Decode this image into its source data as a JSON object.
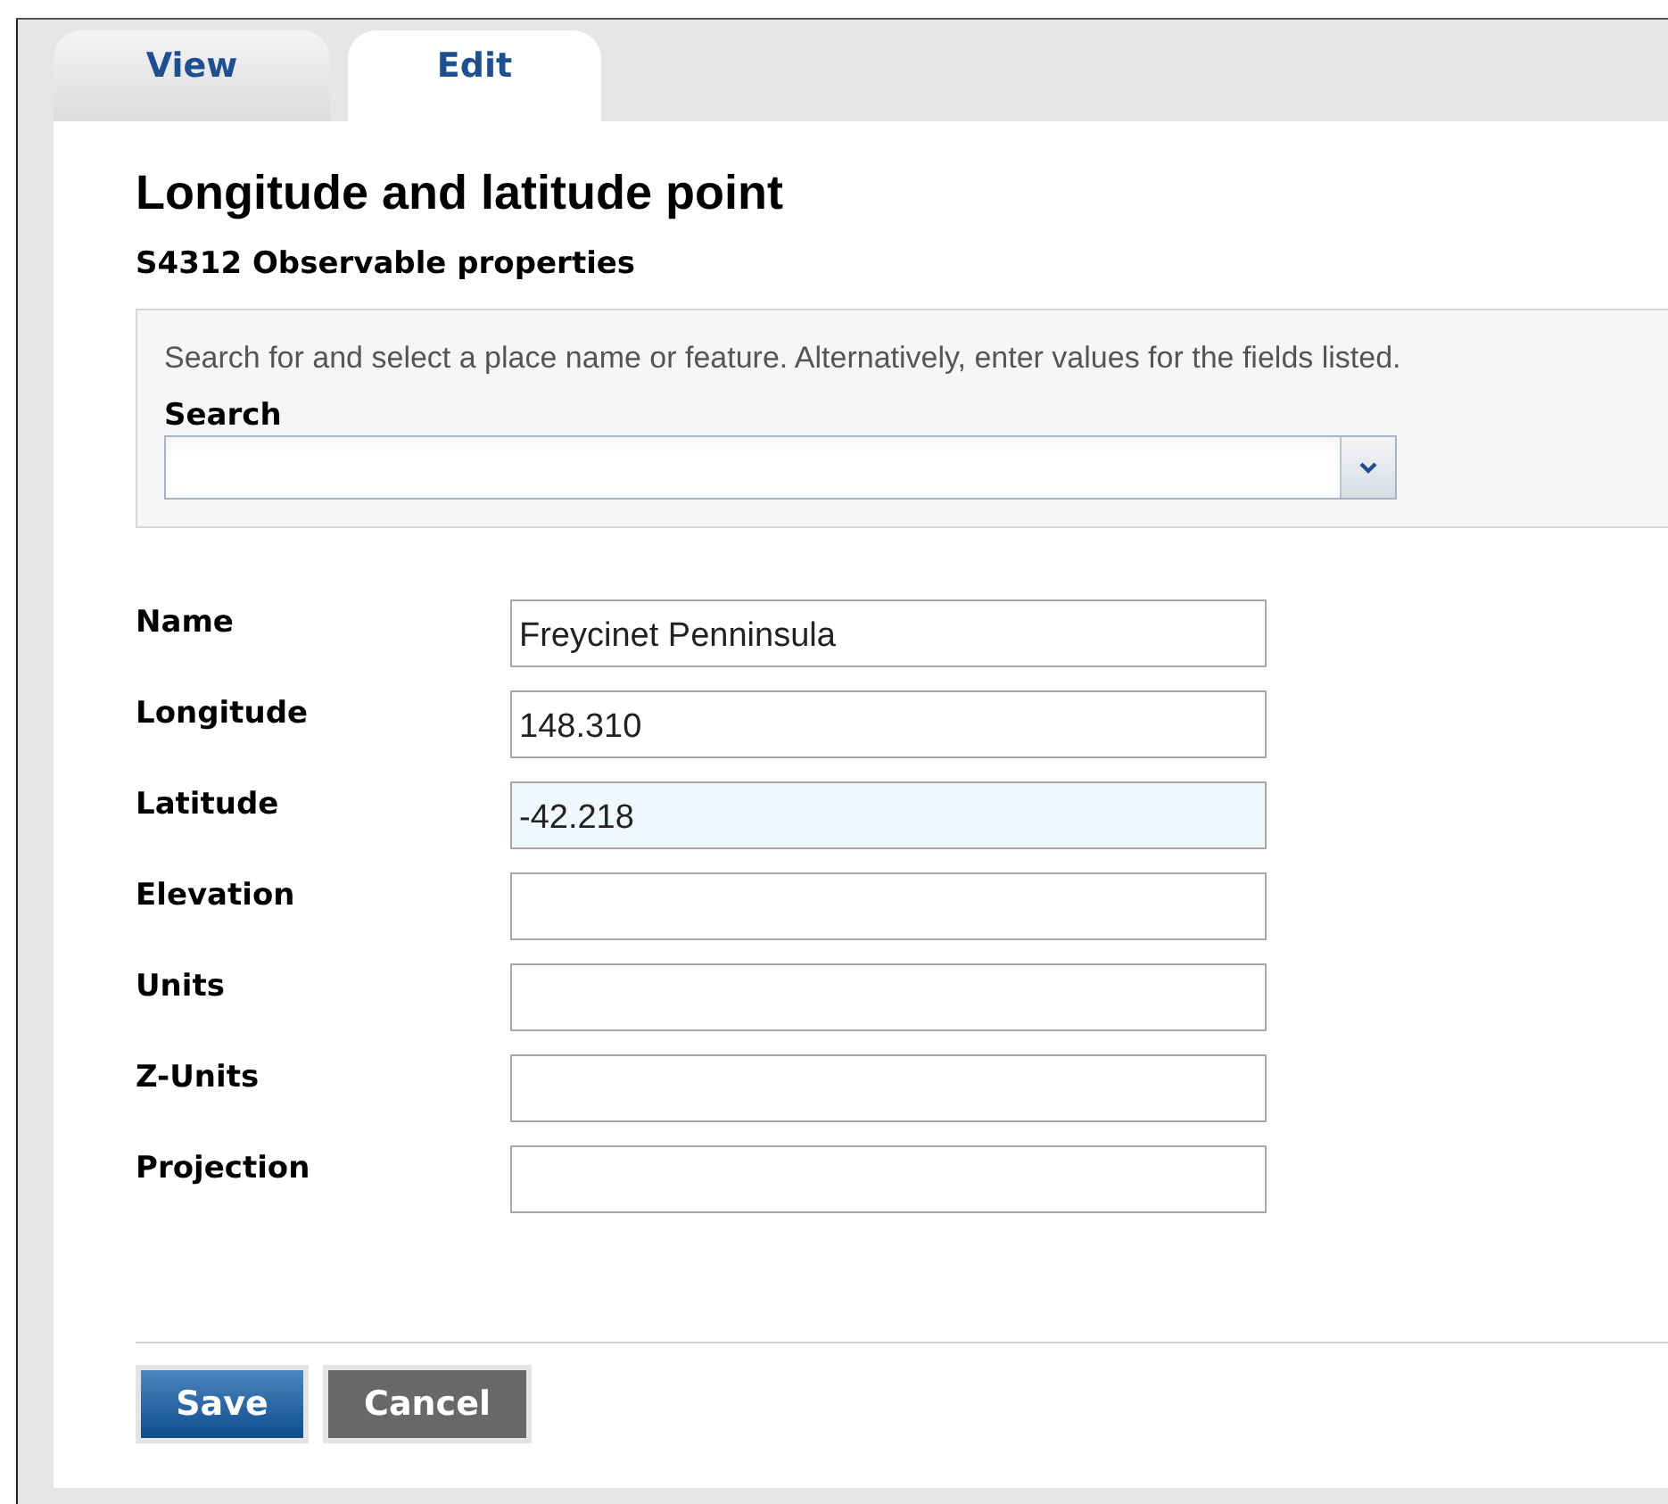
{
  "tabs": [
    {
      "label": "View",
      "selected": false
    },
    {
      "label": "Edit",
      "selected": true
    }
  ],
  "heading": "Longitude and latitude point",
  "subheading": "S4312 Observable properties",
  "search_panel": {
    "intro": "Search for and select a place name or feature. Alternatively, enter values for the fields listed.",
    "label": "Search"
  },
  "fields": [
    {
      "label": "Name",
      "value": "Freycinet Penninsula",
      "focused": false
    },
    {
      "label": "Longitude",
      "value": "148.310",
      "focused": false
    },
    {
      "label": "Latitude",
      "value": "-42.218",
      "focused": true
    },
    {
      "label": "Elevation",
      "focused": false
    },
    {
      "label": "Units",
      "focused": false
    },
    {
      "label": "Z-Units",
      "focused": false
    },
    {
      "label": "Projection",
      "focused": false
    }
  ],
  "buttons": [
    {
      "label": "Save",
      "kind": "primary"
    },
    {
      "label": "Cancel",
      "kind": "secondary"
    }
  ]
}
